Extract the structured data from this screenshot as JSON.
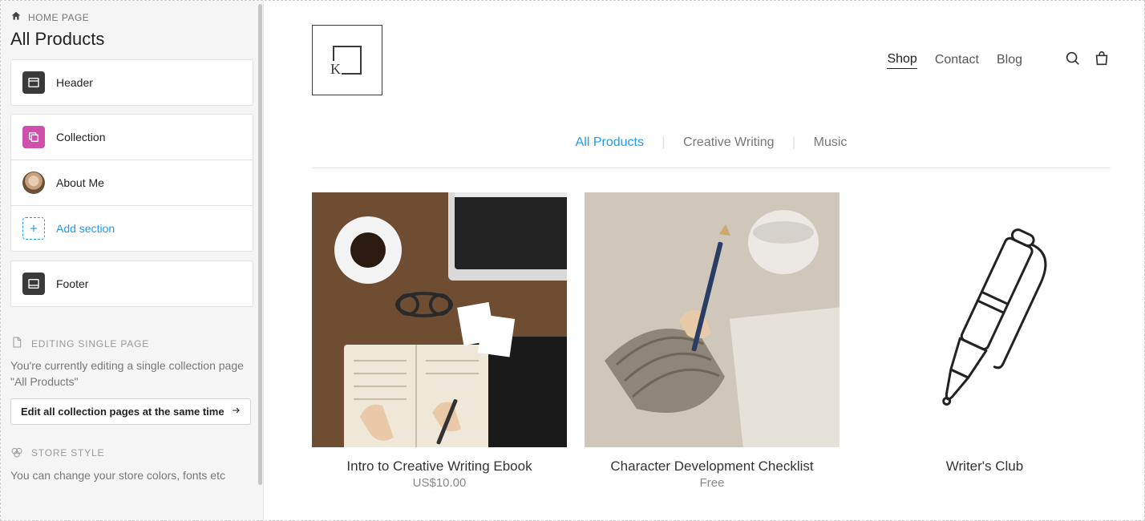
{
  "sidebar": {
    "breadcrumb": "HOME PAGE",
    "page_title": "All Products",
    "sections": {
      "header": "Header",
      "collection": "Collection",
      "about": "About Me",
      "add": "Add section",
      "footer": "Footer"
    },
    "editing": {
      "heading": "EDITING SINGLE PAGE",
      "body": "You're currently editing a single collection page \"All Products\"",
      "button": "Edit all collection pages at the same time"
    },
    "style": {
      "heading": "STORE STYLE",
      "body": "You can change your store colors, fonts etc"
    }
  },
  "store": {
    "nav": {
      "shop": "Shop",
      "contact": "Contact",
      "blog": "Blog"
    },
    "filters": {
      "all": "All Products",
      "writing": "Creative Writing",
      "music": "Music"
    },
    "products": [
      {
        "title": "Intro to Creative Writing Ebook",
        "price": "US$10.00"
      },
      {
        "title": "Character Development Checklist",
        "price": "Free"
      },
      {
        "title": "Writer's Club",
        "price": ""
      }
    ]
  }
}
